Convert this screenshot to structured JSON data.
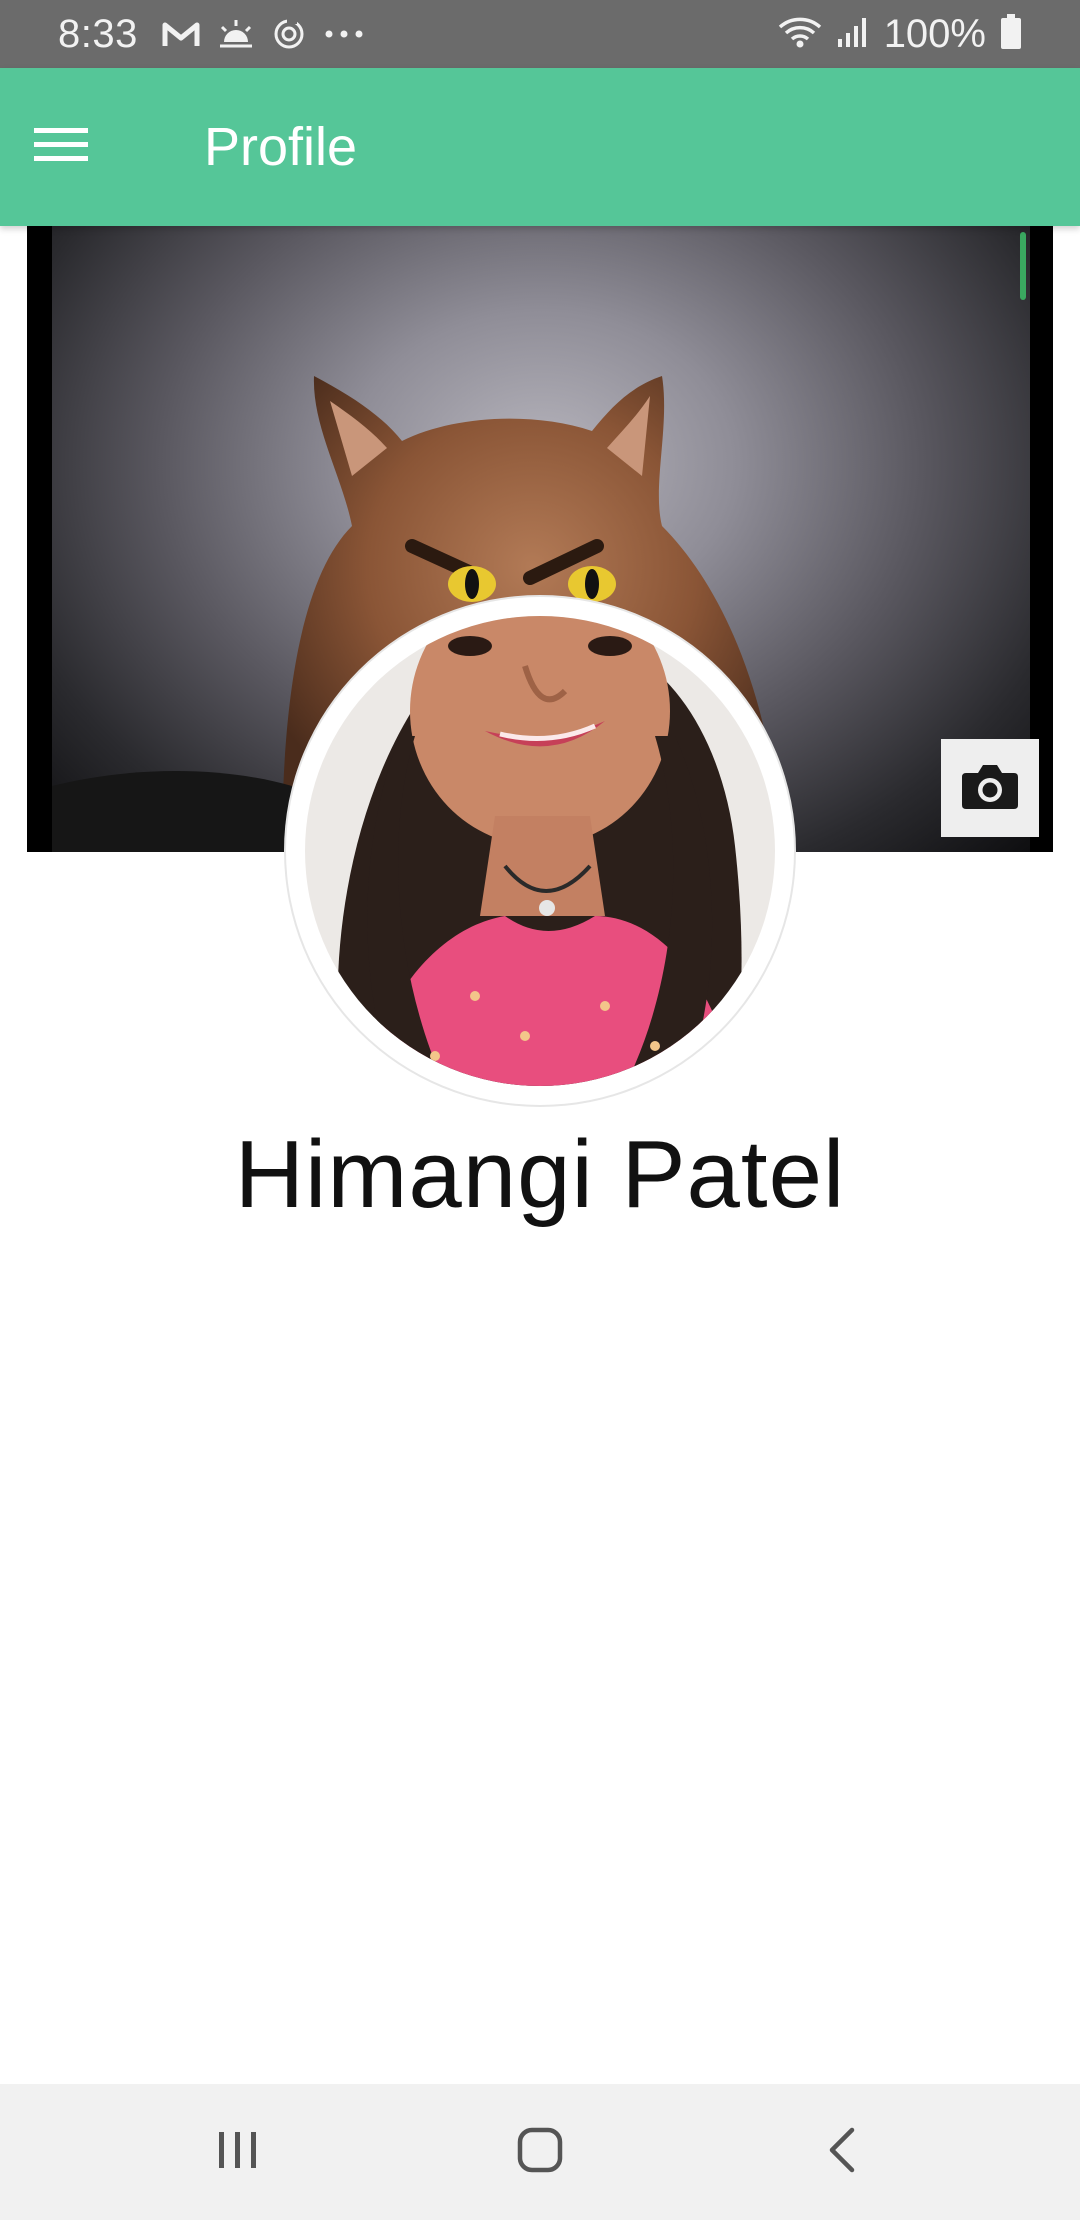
{
  "status_bar": {
    "time": "8:33",
    "battery_text": "100%",
    "notification_icons": [
      "gmail-icon",
      "weather-sun-icon",
      "sync-icon",
      "more-dots-icon"
    ],
    "system_icons": [
      "wifi-icon",
      "signal-icon",
      "battery-icon"
    ]
  },
  "app_bar": {
    "title": "Profile",
    "menu_icon": "hamburger-menu-icon",
    "background_color": "#55c698"
  },
  "cover": {
    "image_subject": "cover-photo-cat",
    "camera_icon": "camera-icon"
  },
  "profile": {
    "name": "Himangi Patel",
    "avatar": "profile-avatar-photo"
  },
  "nav_bar": {
    "buttons": [
      "recent-apps-icon",
      "home-icon",
      "back-icon"
    ]
  }
}
